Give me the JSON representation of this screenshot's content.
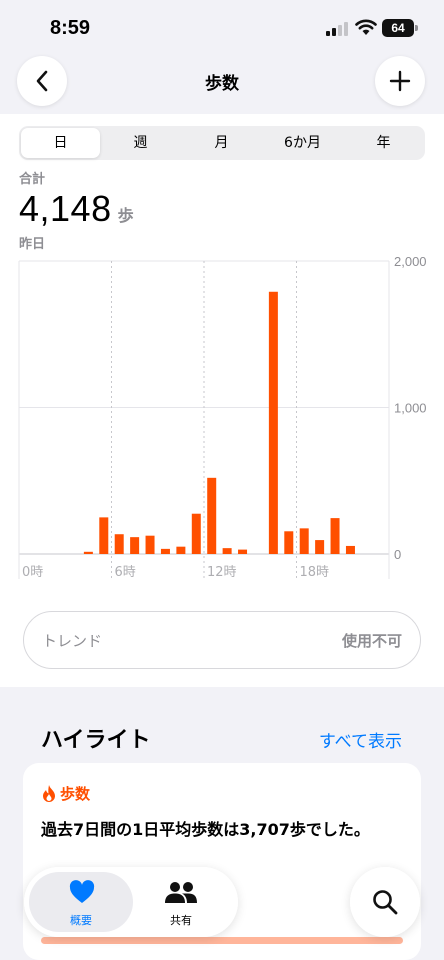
{
  "status_bar": {
    "time": "8:59",
    "battery": "64"
  },
  "nav": {
    "title": "歩数"
  },
  "segments": [
    "日",
    "週",
    "月",
    "6か月",
    "年"
  ],
  "selected_segment": 0,
  "summary": {
    "label": "合計",
    "value": "4,148",
    "unit": "歩",
    "date": "昨日"
  },
  "chart_data": {
    "type": "bar",
    "color": "#ff4f00",
    "x_ticks": [
      "0時",
      "6時",
      "12時",
      "18時"
    ],
    "y_ticks": [
      "2,000",
      "1,000",
      "0"
    ],
    "ylim": [
      0,
      2000
    ],
    "grid": true,
    "hours": [
      0,
      1,
      2,
      3,
      4,
      5,
      6,
      7,
      8,
      9,
      10,
      11,
      12,
      13,
      14,
      15,
      16,
      17,
      18,
      19,
      20,
      21,
      22,
      23
    ],
    "values": [
      0,
      0,
      0,
      0,
      15,
      250,
      135,
      115,
      125,
      35,
      50,
      275,
      520,
      40,
      30,
      0,
      1790,
      155,
      175,
      95,
      245,
      55,
      0,
      0
    ]
  },
  "trend": {
    "label": "トレンド",
    "value": "使用不可"
  },
  "highlights": {
    "title": "ハイライト",
    "show_all": "すべて表示",
    "card": {
      "category": "歩数",
      "message": "過去7日間の1日平均歩数は3,707歩でした。"
    }
  },
  "tabs": [
    {
      "label": "概要"
    },
    {
      "label": "共有"
    }
  ],
  "accent": "#007aff",
  "steps_color": "#ff4f00"
}
